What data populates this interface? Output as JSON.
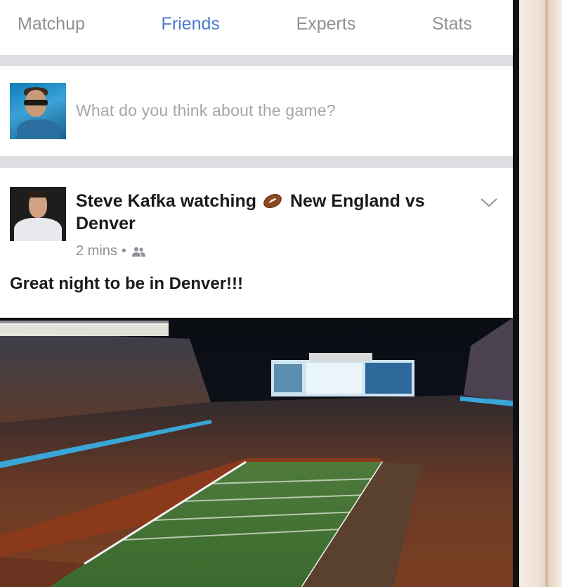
{
  "tabs": [
    {
      "label": "Matchup",
      "active": false
    },
    {
      "label": "Friends",
      "active": true
    },
    {
      "label": "Experts",
      "active": false
    },
    {
      "label": "Stats",
      "active": false
    }
  ],
  "composer": {
    "placeholder": "What do you think about the game?"
  },
  "post": {
    "author": "Steve Kafka",
    "activity": "watching",
    "activity_icon": "football-icon",
    "game": "New England vs Denver",
    "time": "2 mins",
    "audience_icon": "friends-icon",
    "text": "Great night to be in Denver!!!",
    "image": "stadium-photo"
  },
  "colors": {
    "active_tab": "#4a7bd0",
    "inactive_tab": "#8e9196",
    "separator": "#dcdee2"
  }
}
